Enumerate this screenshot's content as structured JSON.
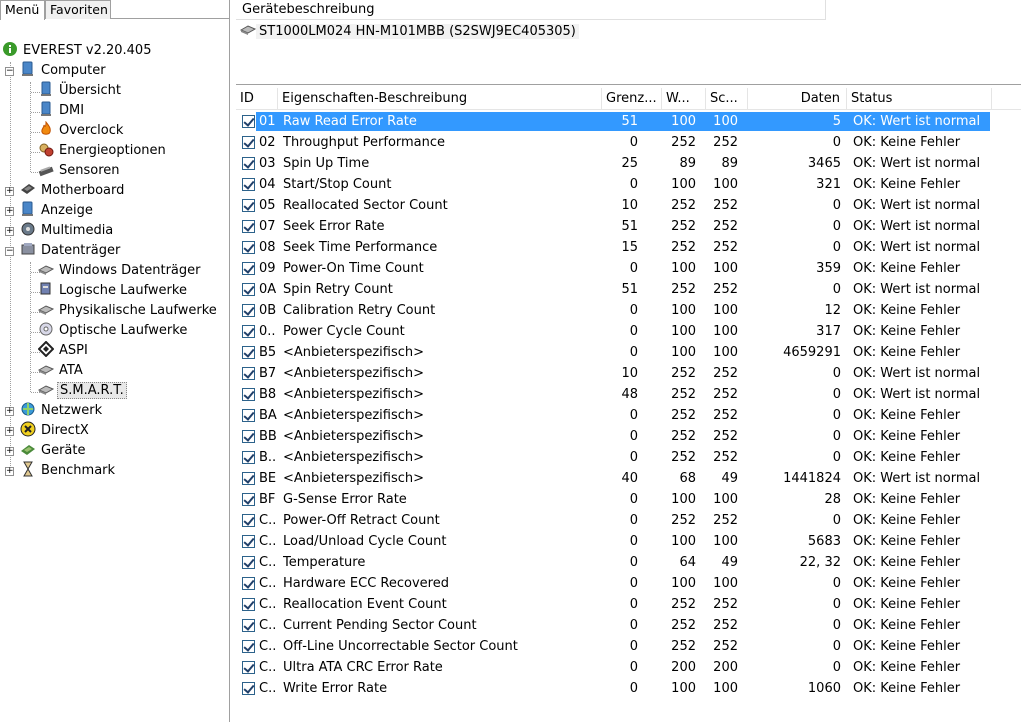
{
  "tabs": {
    "menu": "Menü",
    "favorites": "Favoriten"
  },
  "tree": {
    "root": "EVEREST v2.20.405",
    "computer": "Computer",
    "computer_children": [
      "Übersicht",
      "DMI",
      "Overclock",
      "Energieoptionen",
      "Sensoren"
    ],
    "motherboard": "Motherboard",
    "anzeige": "Anzeige",
    "multimedia": "Multimedia",
    "datentraeger": "Datenträger",
    "datentraeger_children": [
      "Windows Datenträger",
      "Logische Laufwerke",
      "Physikalische Laufwerke",
      "Optische Laufwerke",
      "ASPI",
      "ATA",
      "S.M.A.R.T."
    ],
    "netzwerk": "Netzwerk",
    "directx": "DirectX",
    "geraete": "Geräte",
    "benchmark": "Benchmark"
  },
  "device": {
    "header": "Gerätebeschreibung",
    "name": "ST1000LM024 HN-M101MBB (S2SWJ9EC405305)"
  },
  "grid": {
    "columns": {
      "id": "ID",
      "desc": "Eigenschaften-Beschreibung",
      "thr": "Grenz...",
      "val": "W...",
      "wor": "Sc...",
      "data": "Daten",
      "status": "Status"
    },
    "rows": [
      {
        "id": "01",
        "desc": "Raw Read Error Rate",
        "thr": "51",
        "val": "100",
        "wor": "100",
        "data": "5",
        "status": "OK: Wert ist normal"
      },
      {
        "id": "02",
        "desc": "Throughput Performance",
        "thr": "0",
        "val": "252",
        "wor": "252",
        "data": "0",
        "status": "OK: Keine Fehler"
      },
      {
        "id": "03",
        "desc": "Spin Up Time",
        "thr": "25",
        "val": "89",
        "wor": "89",
        "data": "3465",
        "status": "OK: Wert ist normal"
      },
      {
        "id": "04",
        "desc": "Start/Stop Count",
        "thr": "0",
        "val": "100",
        "wor": "100",
        "data": "321",
        "status": "OK: Keine Fehler"
      },
      {
        "id": "05",
        "desc": "Reallocated Sector Count",
        "thr": "10",
        "val": "252",
        "wor": "252",
        "data": "0",
        "status": "OK: Wert ist normal"
      },
      {
        "id": "07",
        "desc": "Seek Error Rate",
        "thr": "51",
        "val": "252",
        "wor": "252",
        "data": "0",
        "status": "OK: Wert ist normal"
      },
      {
        "id": "08",
        "desc": "Seek Time Performance",
        "thr": "15",
        "val": "252",
        "wor": "252",
        "data": "0",
        "status": "OK: Wert ist normal"
      },
      {
        "id": "09",
        "desc": "Power-On Time Count",
        "thr": "0",
        "val": "100",
        "wor": "100",
        "data": "359",
        "status": "OK: Keine Fehler"
      },
      {
        "id": "0A",
        "desc": "Spin Retry Count",
        "thr": "51",
        "val": "252",
        "wor": "252",
        "data": "0",
        "status": "OK: Wert ist normal"
      },
      {
        "id": "0B",
        "desc": "Calibration Retry Count",
        "thr": "0",
        "val": "100",
        "wor": "100",
        "data": "12",
        "status": "OK: Keine Fehler"
      },
      {
        "id": "0..",
        "desc": "Power Cycle Count",
        "thr": "0",
        "val": "100",
        "wor": "100",
        "data": "317",
        "status": "OK: Keine Fehler"
      },
      {
        "id": "B5",
        "desc": "<Anbieterspezifisch>",
        "thr": "0",
        "val": "100",
        "wor": "100",
        "data": "4659291",
        "status": "OK: Keine Fehler"
      },
      {
        "id": "B7",
        "desc": "<Anbieterspezifisch>",
        "thr": "10",
        "val": "252",
        "wor": "252",
        "data": "0",
        "status": "OK: Wert ist normal"
      },
      {
        "id": "B8",
        "desc": "<Anbieterspezifisch>",
        "thr": "48",
        "val": "252",
        "wor": "252",
        "data": "0",
        "status": "OK: Wert ist normal"
      },
      {
        "id": "BA",
        "desc": "<Anbieterspezifisch>",
        "thr": "0",
        "val": "252",
        "wor": "252",
        "data": "0",
        "status": "OK: Keine Fehler"
      },
      {
        "id": "BB",
        "desc": "<Anbieterspezifisch>",
        "thr": "0",
        "val": "252",
        "wor": "252",
        "data": "0",
        "status": "OK: Keine Fehler"
      },
      {
        "id": "B..",
        "desc": "<Anbieterspezifisch>",
        "thr": "0",
        "val": "252",
        "wor": "252",
        "data": "0",
        "status": "OK: Keine Fehler"
      },
      {
        "id": "BE",
        "desc": "<Anbieterspezifisch>",
        "thr": "40",
        "val": "68",
        "wor": "49",
        "data": "1441824",
        "status": "OK: Wert ist normal"
      },
      {
        "id": "BF",
        "desc": "G-Sense Error Rate",
        "thr": "0",
        "val": "100",
        "wor": "100",
        "data": "28",
        "status": "OK: Keine Fehler"
      },
      {
        "id": "C..",
        "desc": "Power-Off Retract Count",
        "thr": "0",
        "val": "252",
        "wor": "252",
        "data": "0",
        "status": "OK: Keine Fehler"
      },
      {
        "id": "C..",
        "desc": "Load/Unload Cycle Count",
        "thr": "0",
        "val": "100",
        "wor": "100",
        "data": "5683",
        "status": "OK: Keine Fehler"
      },
      {
        "id": "C..",
        "desc": "Temperature",
        "thr": "0",
        "val": "64",
        "wor": "49",
        "data": "22, 32",
        "status": "OK: Keine Fehler"
      },
      {
        "id": "C..",
        "desc": "Hardware ECC Recovered",
        "thr": "0",
        "val": "100",
        "wor": "100",
        "data": "0",
        "status": "OK: Keine Fehler"
      },
      {
        "id": "C..",
        "desc": "Reallocation Event Count",
        "thr": "0",
        "val": "252",
        "wor": "252",
        "data": "0",
        "status": "OK: Keine Fehler"
      },
      {
        "id": "C..",
        "desc": "Current Pending Sector Count",
        "thr": "0",
        "val": "252",
        "wor": "252",
        "data": "0",
        "status": "OK: Keine Fehler"
      },
      {
        "id": "C..",
        "desc": "Off-Line Uncorrectable Sector Count",
        "thr": "0",
        "val": "252",
        "wor": "252",
        "data": "0",
        "status": "OK: Keine Fehler"
      },
      {
        "id": "C..",
        "desc": "Ultra ATA CRC Error Rate",
        "thr": "0",
        "val": "200",
        "wor": "200",
        "data": "0",
        "status": "OK: Keine Fehler"
      },
      {
        "id": "C..",
        "desc": "Write Error Rate",
        "thr": "0",
        "val": "100",
        "wor": "100",
        "data": "1060",
        "status": "OK: Keine Fehler"
      }
    ]
  },
  "colors": {
    "selection": "#3399ff",
    "checkbox_border": "#2c628b"
  }
}
